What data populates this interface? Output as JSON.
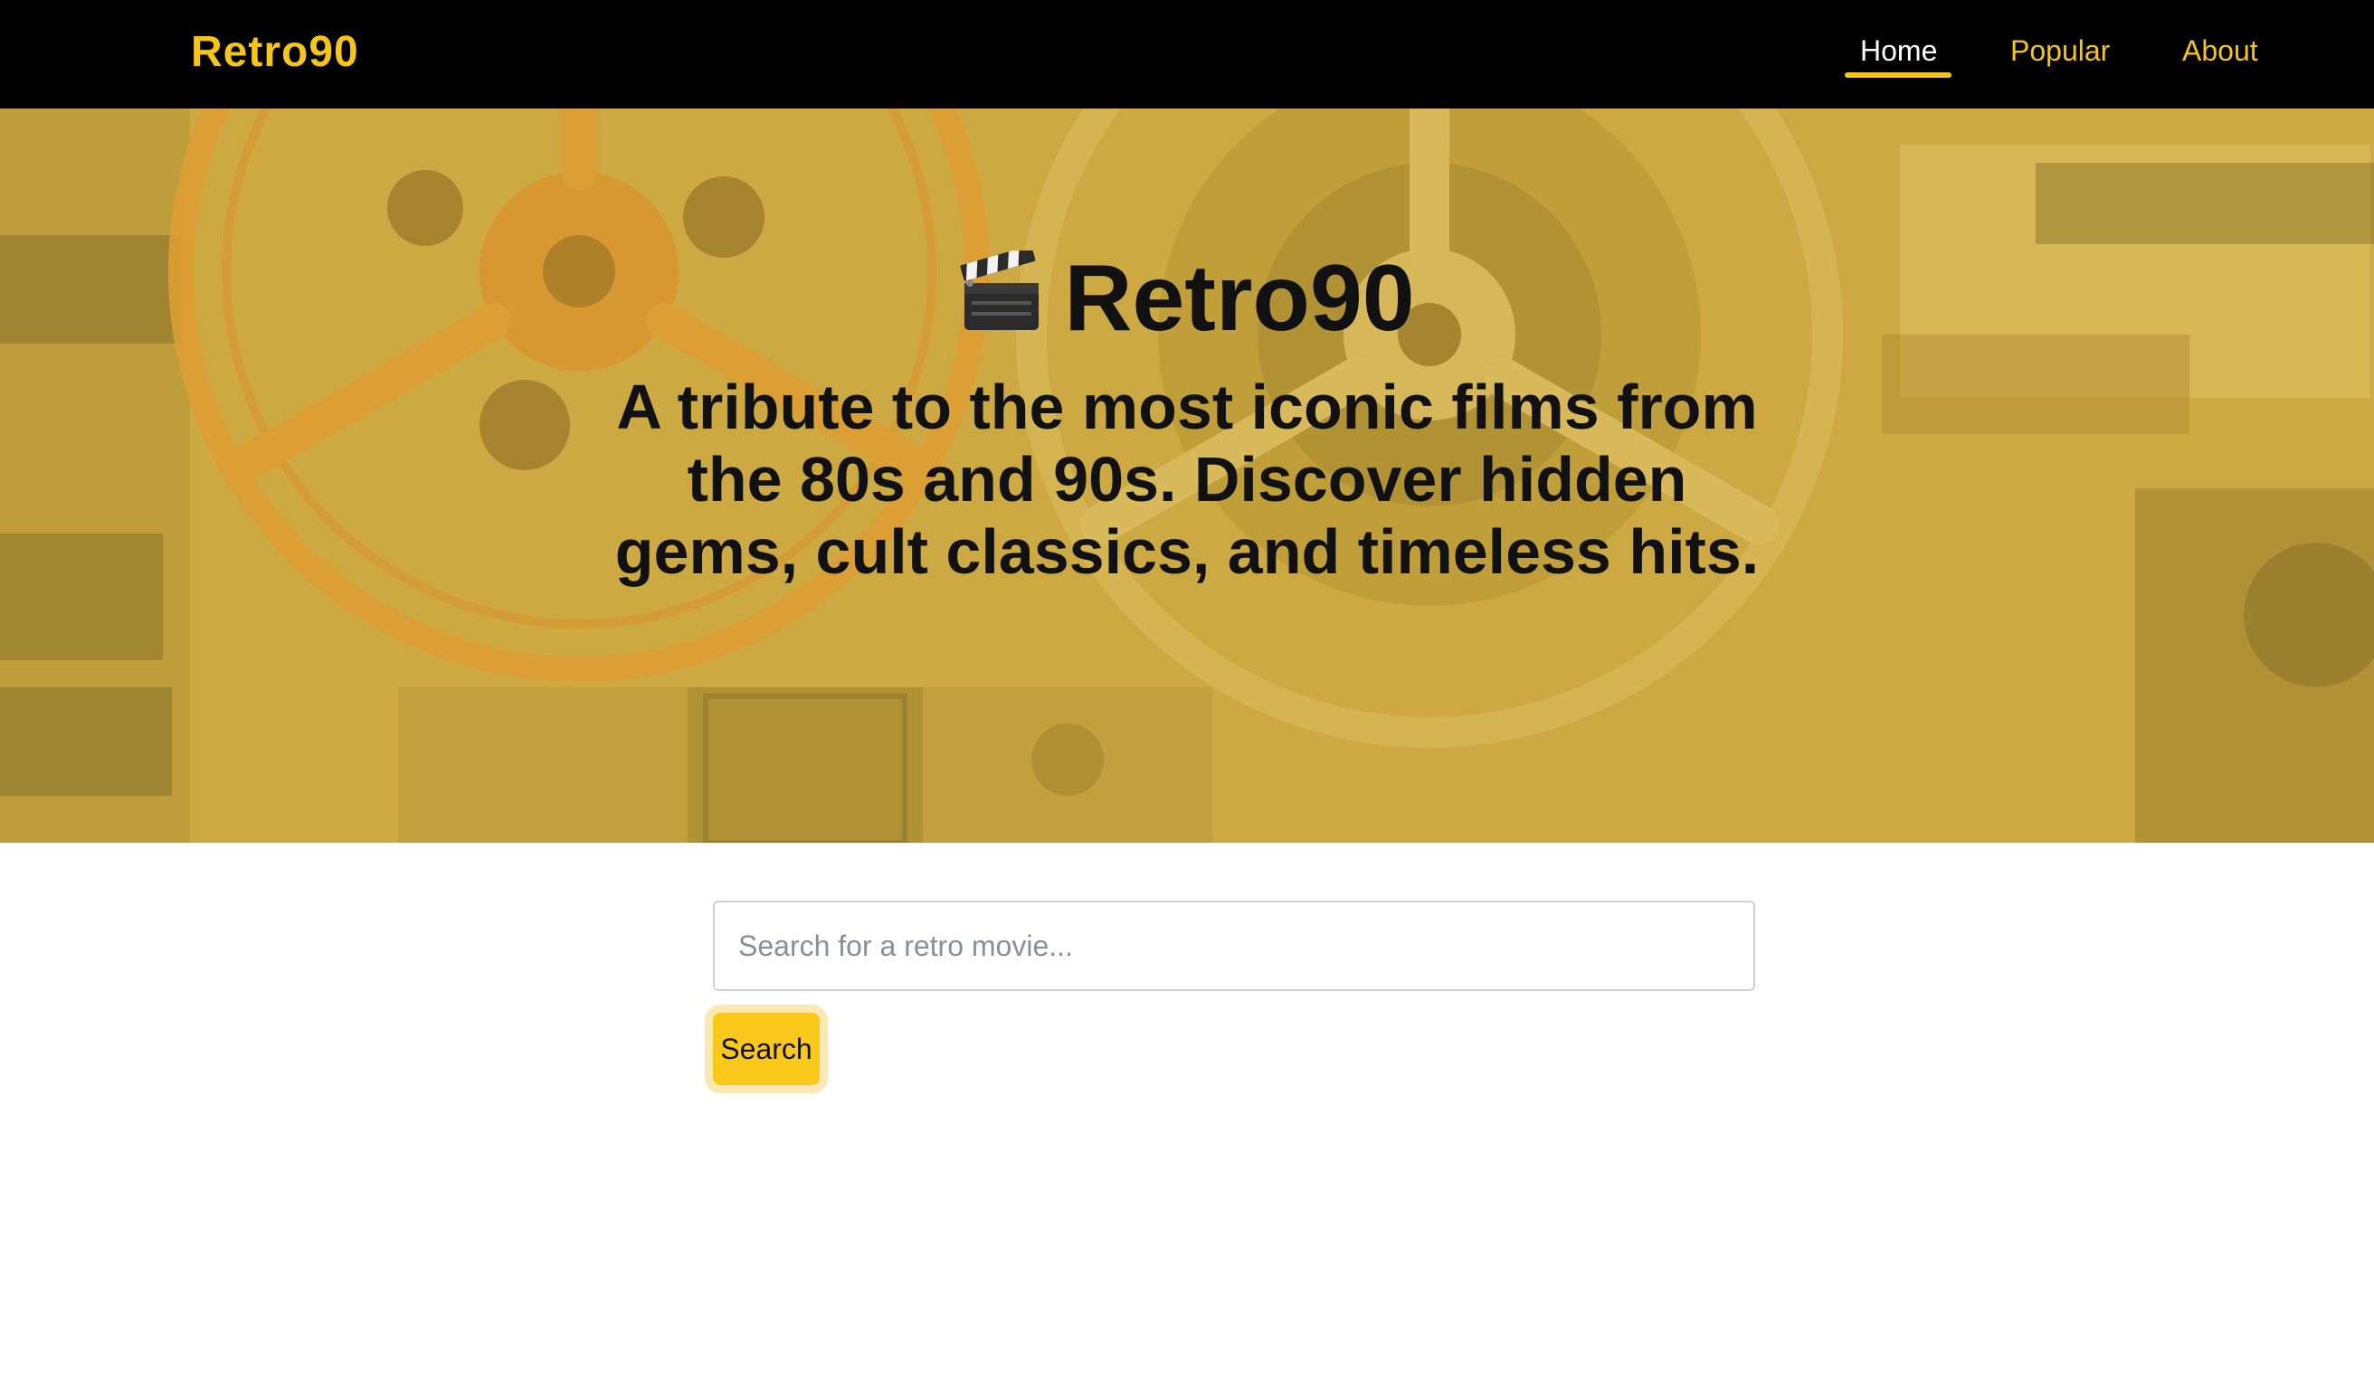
{
  "navbar": {
    "brand": "Retro90",
    "links": [
      {
        "label": "Home",
        "active": true
      },
      {
        "label": "Popular",
        "active": false
      },
      {
        "label": "About",
        "active": false
      }
    ]
  },
  "hero": {
    "icon": "clapperboard-icon",
    "title": "Retro90",
    "tagline": "A tribute to the most iconic films from the 80s and 90s. Discover hidden gems, cult classics, and timeless hits.",
    "background": "film-reels-photo"
  },
  "search": {
    "placeholder": "Search for a retro movie...",
    "value": "",
    "button_label": "Search"
  },
  "colors": {
    "navbar_bg": "#000000",
    "accent": "#f5c518",
    "hero_tint": "#c9a63f",
    "button_bg": "#f8c81a",
    "button_focus_ring": "#fbe8b4"
  }
}
